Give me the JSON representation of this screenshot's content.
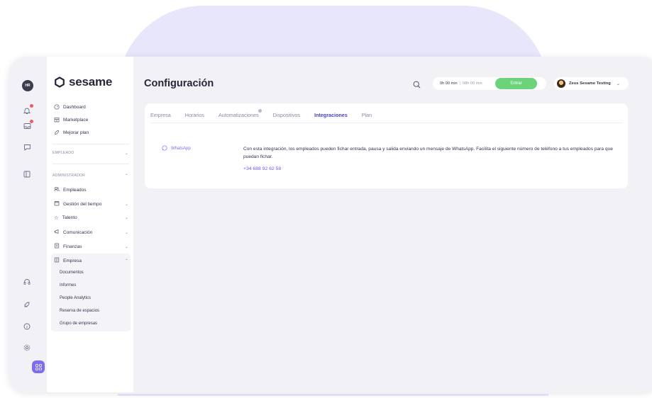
{
  "brand": {
    "logo_text": "sesame",
    "accent": "#7b6cf0",
    "enter_color": "#6bd47a"
  },
  "rail": {
    "avatar_initials": "HR",
    "icons": [
      "bell-icon",
      "inbox-icon",
      "chat-icon",
      "layout-icon",
      "headset-icon",
      "rocket-icon",
      "info-icon",
      "gear-icon",
      "apps-icon"
    ]
  },
  "sidebar": {
    "top_links": [
      {
        "label": "Dashboard",
        "icon": "dashboard-icon"
      },
      {
        "label": "Marketplace",
        "icon": "marketplace-icon"
      },
      {
        "label": "Mejorar plan",
        "icon": "upgrade-icon"
      }
    ],
    "section_empleado": "EMPLEADO",
    "section_admin": "ADMINISTRADOR",
    "admin_items": [
      {
        "label": "Empleados",
        "icon": "employees-icon"
      },
      {
        "label": "Gestión del tiempo",
        "icon": "time-icon"
      },
      {
        "label": "Talento",
        "icon": "star-icon"
      },
      {
        "label": "Comunicación",
        "icon": "communication-icon"
      },
      {
        "label": "Finanzas",
        "icon": "finance-icon"
      },
      {
        "label": "Empresa",
        "icon": "company-icon"
      }
    ],
    "empresa_sub": [
      "Documentos",
      "Informes",
      "People Analytics",
      "Reserva de espacios",
      "Grupo de empresas"
    ]
  },
  "header": {
    "title": "Configuración",
    "worked": "0h 00 min",
    "total": "08h 00 min",
    "enter_label": "Entrar",
    "user_name": "Zeus Sesame Testing"
  },
  "tabs": [
    "Empresa",
    "Horarios",
    "Automatizaciones",
    "Dispositivos",
    "Integraciones",
    "Plan"
  ],
  "active_tab": "Integraciones",
  "integration": {
    "name": "WhatsApp",
    "description": "Con esta integración, los empleados pueden fichar entrada, pausa y salida enviando un mensaje de WhatsApp. Facilita el siguiente número de teléfono a tus empleados para que puedan fichar.",
    "phone": "+34 688 92 62 58"
  }
}
